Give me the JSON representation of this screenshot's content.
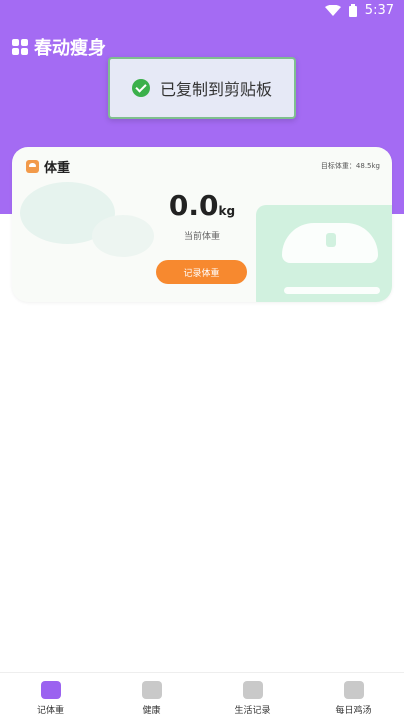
{
  "status_bar": {
    "time": "5:37"
  },
  "app": {
    "title": "春动瘦身"
  },
  "toast": {
    "text": "已复制到剪贴板"
  },
  "weight_card": {
    "title": "体重",
    "target_text": "目标体重：48.5kg",
    "value": "0.0",
    "unit": "kg",
    "label": "当前体重",
    "record_button": "记录体重"
  },
  "bottom_nav": {
    "items": [
      {
        "label": "记体重",
        "icon": "scale-icon",
        "active": true
      },
      {
        "label": "健康",
        "icon": "heartbeat-icon",
        "active": false
      },
      {
        "label": "生活记录",
        "icon": "document-icon",
        "active": false
      },
      {
        "label": "每日鸡汤",
        "icon": "book-icon",
        "active": false
      }
    ]
  },
  "colors": {
    "primary": "#a46bf3",
    "accent": "#f7892f",
    "scale_bg": "#d1f1df"
  }
}
